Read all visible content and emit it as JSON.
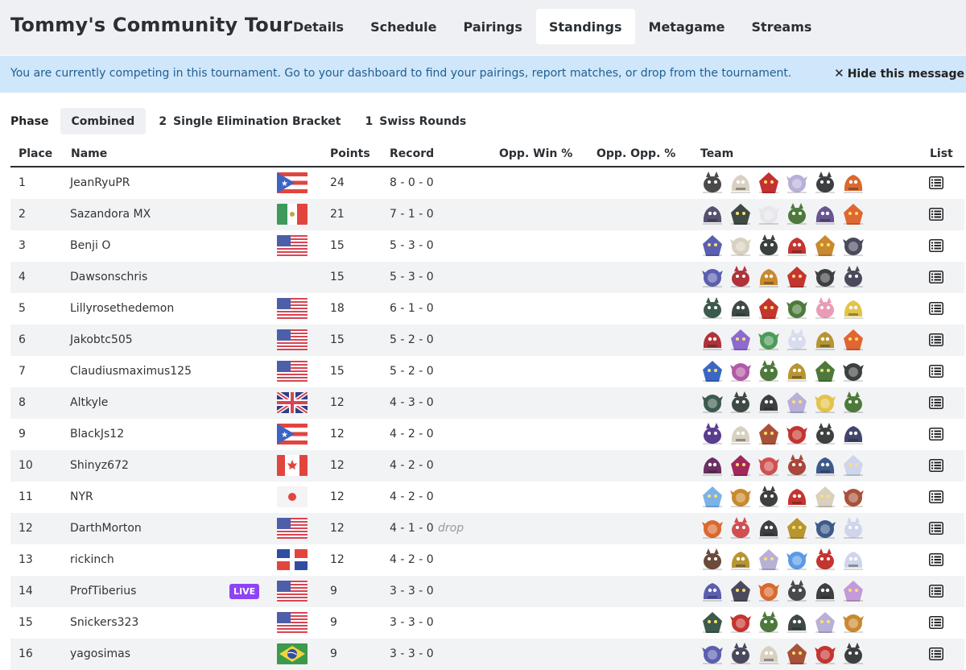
{
  "app": {
    "title": "Tommy's Community Tour",
    "tabs": [
      "Details",
      "Schedule",
      "Pairings",
      "Standings",
      "Metagame",
      "Streams"
    ],
    "active_tab": "Standings"
  },
  "notice": {
    "text": "You are currently competing in this tournament. Go to your dashboard to find your pairings, report matches, or drop from the tournament.",
    "hide_label": "Hide this message"
  },
  "phase": {
    "label": "Phase",
    "options": [
      {
        "num": "",
        "label": "Combined"
      },
      {
        "num": "2",
        "label": "Single Elimination Bracket"
      },
      {
        "num": "1",
        "label": "Swiss Rounds"
      }
    ]
  },
  "table": {
    "headers": {
      "place": "Place",
      "name": "Name",
      "points": "Points",
      "record": "Record",
      "opp_win": "Opp. Win %",
      "opp_opp": "Opp. Opp. %",
      "team": "Team",
      "list": "List"
    },
    "rows": [
      {
        "place": "1",
        "name": "JeanRyuPR",
        "flag": "puerto-rico",
        "points": "24",
        "record": "8 - 0 - 0",
        "team": [
          "#4a4a4a",
          "#d9d2c2",
          "#c33131",
          "#b9b0d8",
          "#3d4040",
          "#d9692e"
        ]
      },
      {
        "place": "2",
        "name": "Sazandora MX",
        "flag": "mexico",
        "points": "21",
        "record": "7 - 1 - 0",
        "team": [
          "#575171",
          "#3f4a45",
          "#e6e6ec",
          "#4d7a3c",
          "#68548f",
          "#e06632"
        ]
      },
      {
        "place": "3",
        "name": "Benji O",
        "flag": "usa",
        "points": "15",
        "record": "5 - 3 - 0",
        "team": [
          "#5b5fb0",
          "#d8d1bf",
          "#3d4040",
          "#c43530",
          "#c9892f",
          "#4b4a5c"
        ]
      },
      {
        "place": "4",
        "name": "Dawsonschris",
        "flag": "",
        "points": "15",
        "record": "5 - 3 - 0",
        "team": [
          "#5b5fb0",
          "#b0323a",
          "#c9892f",
          "#c43530",
          "#3d4040",
          "#4b4a5c"
        ]
      },
      {
        "place": "5",
        "name": "Lillyrosethedemon",
        "flag": "usa",
        "points": "18",
        "record": "6 - 1 - 0",
        "team": [
          "#3c5a4d",
          "#3f4a45",
          "#c43530",
          "#4d7a3c",
          "#e99cb6",
          "#e3c34a"
        ]
      },
      {
        "place": "6",
        "name": "Jakobtc505",
        "flag": "usa",
        "points": "15",
        "record": "5 - 2 - 0",
        "team": [
          "#b0323a",
          "#8c6ad0",
          "#4d9a5a",
          "#d9dcef",
          "#b79531",
          "#e06632"
        ]
      },
      {
        "place": "7",
        "name": "Claudiusmaximus125",
        "flag": "usa",
        "points": "15",
        "record": "5 - 2 - 0",
        "team": [
          "#3a67c4",
          "#b25aa6",
          "#4d7a3c",
          "#b79531",
          "#4d7a3c",
          "#3d4040"
        ]
      },
      {
        "place": "8",
        "name": "Altkyle",
        "flag": "uk",
        "points": "12",
        "record": "4 - 3 - 0",
        "team": [
          "#3c5a4d",
          "#3f4a45",
          "#3d4040",
          "#b9b0d8",
          "#e3c34a",
          "#4d7a3c"
        ]
      },
      {
        "place": "9",
        "name": "BlackJs12",
        "flag": "puerto-rico",
        "points": "12",
        "record": "4 - 2 - 0",
        "team": [
          "#5a3d8e",
          "#d8d1bf",
          "#a8523a",
          "#c43530",
          "#3d4040",
          "#43456b"
        ]
      },
      {
        "place": "10",
        "name": "Shinyz672",
        "flag": "canada",
        "points": "12",
        "record": "4 - 2 - 0",
        "team": [
          "#6b2f62",
          "#a2285a",
          "#d05050",
          "#a9473a",
          "#3d5a8a",
          "#cfd5ea"
        ]
      },
      {
        "place": "11",
        "name": "NYR",
        "flag": "japan",
        "points": "12",
        "record": "4 - 2 - 0",
        "team": [
          "#7bb3e8",
          "#c9892f",
          "#3d4040",
          "#c43530",
          "#d8d1bf",
          "#a8523a"
        ]
      },
      {
        "place": "12",
        "name": "DarthMorton",
        "flag": "usa",
        "points": "12",
        "record": "4 - 1 - 0",
        "drop": "drop",
        "team": [
          "#d9692e",
          "#d05050",
          "#3d4040",
          "#b79531",
          "#3d5a8a",
          "#cfd5ea"
        ]
      },
      {
        "place": "13",
        "name": "rickinch",
        "flag": "dominican",
        "points": "12",
        "record": "4 - 2 - 0",
        "team": [
          "#6b4b3a",
          "#b79531",
          "#b9b0d8",
          "#5a9ae6",
          "#c43530",
          "#cfd5ea"
        ]
      },
      {
        "place": "14",
        "name": "ProfTiberius",
        "flag": "usa",
        "live": "LIVE",
        "points": "9",
        "record": "3 - 3 - 0",
        "team": [
          "#5b5fb0",
          "#4b4a5c",
          "#d9692e",
          "#4a4a4a",
          "#3d4040",
          "#c29bd8"
        ]
      },
      {
        "place": "15",
        "name": "Snickers323",
        "flag": "usa",
        "points": "9",
        "record": "3 - 3 - 0",
        "team": [
          "#3c5a4d",
          "#c43530",
          "#4d7a3c",
          "#3f4a45",
          "#b9b0d8",
          "#c9892f"
        ]
      },
      {
        "place": "16",
        "name": "yagosimas",
        "flag": "brazil",
        "points": "9",
        "record": "3 - 3 - 0",
        "team": [
          "#5b5fb0",
          "#4b4a5c",
          "#d8d1bf",
          "#a8523a",
          "#c43530",
          "#3d4040"
        ]
      }
    ]
  }
}
